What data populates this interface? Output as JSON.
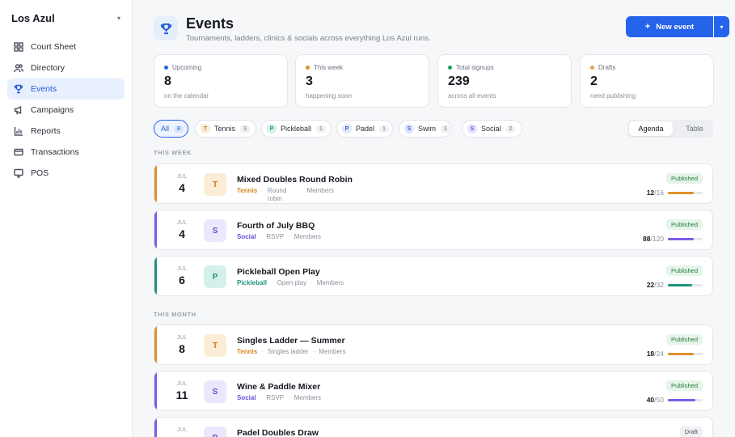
{
  "org": {
    "name": "Los Azul"
  },
  "sidebar": {
    "items": [
      {
        "label": "Court Sheet",
        "icon": "grid-icon"
      },
      {
        "label": "Directory",
        "icon": "users-icon"
      },
      {
        "label": "Events",
        "icon": "trophy-icon",
        "active": true
      },
      {
        "label": "Campaigns",
        "icon": "megaphone-icon"
      },
      {
        "label": "Reports",
        "icon": "bar-chart-icon"
      },
      {
        "label": "Transactions",
        "icon": "credit-card-icon"
      },
      {
        "label": "POS",
        "icon": "monitor-icon"
      }
    ]
  },
  "header": {
    "title": "Events",
    "subtitle": "Tournaments, ladders, clinics & socials across everything Los Azul runs.",
    "new_button": "New event"
  },
  "stats": [
    {
      "label": "Upcoming",
      "value": "8",
      "foot": "on the calendar",
      "color": "#2563eb"
    },
    {
      "label": "This week",
      "value": "3",
      "foot": "happening soon",
      "color": "#e0902a"
    },
    {
      "label": "Total signups",
      "value": "239",
      "foot": "across all events",
      "color": "#22a05a"
    },
    {
      "label": "Drafts",
      "value": "2",
      "foot": "need publishing",
      "color": "#e0a050"
    }
  ],
  "filters": [
    {
      "label": "All",
      "count": "8",
      "letter": ""
    },
    {
      "label": "Tennis",
      "count": "3",
      "letter": "T"
    },
    {
      "label": "Pickleball",
      "count": "1",
      "letter": "P"
    },
    {
      "label": "Padel",
      "count": "1",
      "letter": "P"
    },
    {
      "label": "Swim",
      "count": "1",
      "letter": "S"
    },
    {
      "label": "Social",
      "count": "2",
      "letter": "S"
    }
  ],
  "view_toggle": {
    "agenda": "Agenda",
    "table": "Table"
  },
  "sections": {
    "this_week": "THIS WEEK",
    "this_month": "THIS MONTH"
  },
  "events": [
    {
      "month": "JUL",
      "day": "4",
      "letter": "T",
      "title": "Mixed Doubles Round Robin",
      "category": "Tennis",
      "format": "Round robin",
      "audience": "Members",
      "status": "Published",
      "filled": "12",
      "capacity": "/16",
      "fill_fraction": 0.75,
      "accent": "#e0902a"
    },
    {
      "month": "JUL",
      "day": "4",
      "letter": "S",
      "title": "Fourth of July BBQ",
      "category": "Social",
      "format": "RSVP",
      "audience": "Members",
      "status": "Published",
      "filled": "88",
      "capacity": "/120",
      "fill_fraction": 0.733,
      "accent": "#7c5ce6"
    },
    {
      "month": "JUL",
      "day": "6",
      "letter": "P",
      "title": "Pickleball Open Play",
      "category": "Pickleball",
      "format": "Open play",
      "audience": "Members",
      "status": "Published",
      "filled": "22",
      "capacity": "/32",
      "fill_fraction": 0.6875,
      "accent": "#1f9480"
    },
    {
      "month": "JUL",
      "day": "8",
      "letter": "T",
      "title": "Singles Ladder — Summer",
      "category": "Tennis",
      "format": "Singles ladder",
      "audience": "Members",
      "status": "Published",
      "filled": "18",
      "capacity": "/24",
      "fill_fraction": 0.75,
      "accent": "#e0902a"
    },
    {
      "month": "JUL",
      "day": "11",
      "letter": "S",
      "title": "Wine & Paddle Mixer",
      "category": "Social",
      "format": "RSVP",
      "audience": "Members",
      "status": "Published",
      "filled": "40",
      "capacity": "/50",
      "fill_fraction": 0.8,
      "accent": "#7c5ce6"
    },
    {
      "month": "JUL",
      "day": "",
      "letter": "P",
      "title": "Padel Doubles Draw",
      "category": "",
      "format": "",
      "audience": "",
      "status": "Draft",
      "filled": "",
      "capacity": "",
      "fill_fraction": 0,
      "accent": "#7c5ce6"
    }
  ]
}
